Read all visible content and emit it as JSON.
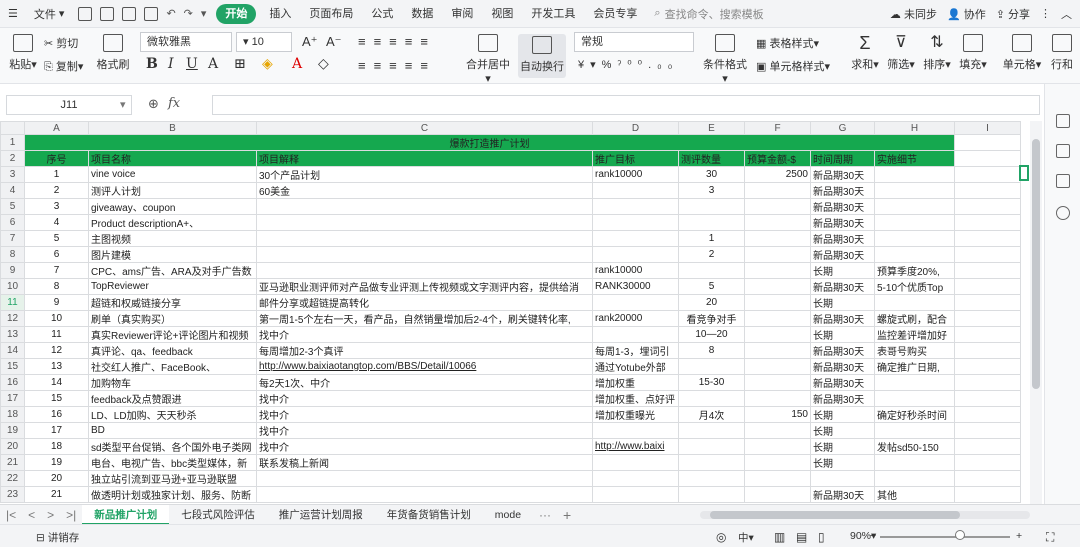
{
  "menubar": {
    "file": "文件",
    "tabs": [
      "开始",
      "插入",
      "页面布局",
      "公式",
      "数据",
      "审阅",
      "视图",
      "开发工具",
      "会员专享"
    ],
    "search_placeholder": "查找命令、搜索模板",
    "sync": "未同步",
    "collab": "协作",
    "share": "分享"
  },
  "ribbon": {
    "paste": "粘贴",
    "cut": "剪切",
    "copy": "复制",
    "format_painter": "格式刷",
    "font_name": "微软雅黑",
    "font_size": "10",
    "merge_center": "合并居中",
    "wrap_text": "自动换行",
    "number_format": "常规",
    "conditional": "条件格式",
    "table_style": "表格样式",
    "cell_style": "单元格样式",
    "sum": "求和",
    "filter": "筛选",
    "sort": "排序",
    "fill": "填充",
    "cell": "单元格",
    "rowcol": "行和"
  },
  "formula": {
    "cell_ref": "J11",
    "fx": "fx",
    "value": ""
  },
  "columns": [
    "A",
    "B",
    "C",
    "D",
    "E",
    "F",
    "G",
    "H",
    "I"
  ],
  "title": "爆款打造推广计划",
  "headers": [
    "序号",
    "项目名称",
    "项目解释",
    "推广目标",
    "测评数量",
    "预算金额-$",
    "时间周期",
    "实施细节"
  ],
  "rows": [
    {
      "r": "3",
      "a": "1",
      "b": "vine voice",
      "c": "30个产品计划",
      "d": "rank10000",
      "e": "30",
      "f": "2500",
      "g": "新品期30天",
      "h": ""
    },
    {
      "r": "4",
      "a": "2",
      "b": "测评人计划",
      "c": "60美金",
      "d": "",
      "e": "3",
      "f": "",
      "g": "新品期30天",
      "h": ""
    },
    {
      "r": "5",
      "a": "3",
      "b": "giveaway、coupon",
      "c": "",
      "d": "",
      "e": "",
      "f": "",
      "g": "新品期30天",
      "h": ""
    },
    {
      "r": "6",
      "a": "4",
      "b": "Product descriptionA+、",
      "c": "",
      "d": "",
      "e": "",
      "f": "",
      "g": "新品期30天",
      "h": ""
    },
    {
      "r": "7",
      "a": "5",
      "b": "主图视频",
      "c": "",
      "d": "",
      "e": "1",
      "f": "",
      "g": "新品期30天",
      "h": ""
    },
    {
      "r": "8",
      "a": "6",
      "b": "图片建模",
      "c": "",
      "d": "",
      "e": "2",
      "f": "",
      "g": "新品期30天",
      "h": ""
    },
    {
      "r": "9",
      "a": "7",
      "b": "CPC、ams广告、ARA及对手广告数",
      "c": "",
      "d": "rank10000",
      "e": "",
      "f": "",
      "g": "长期",
      "h": "预算季度20%,"
    },
    {
      "r": "10",
      "a": "8",
      "b": "TopReviewer",
      "c": "亚马逊职业测评师对产品做专业评测上传视频或文字测评内容，提供给消",
      "d": "RANK30000",
      "e": "5",
      "f": "",
      "g": "新品期30天",
      "h": "5-10个优质Top"
    },
    {
      "r": "11",
      "a": "9",
      "b": "超链和权威链接分享",
      "c": "邮件分享或超链提高转化",
      "d": "",
      "e": "20",
      "f": "",
      "g": "长期",
      "h": ""
    },
    {
      "r": "12",
      "a": "10",
      "b": "刷单（真实购买）",
      "c": "第一周1-5个左右一天，看产品，自然销量增加后2-4个，刷关键转化率,",
      "d": "rank20000",
      "e": "看竞争对手",
      "f": "",
      "g": "新品期30天",
      "h": "螺旋式刷，配合"
    },
    {
      "r": "13",
      "a": "11",
      "b": "真实Reviewer评论+评论图片和视频",
      "c": "找中介",
      "d": "",
      "e": "10—20",
      "f": "",
      "g": "长期",
      "h": "监控差评增加好"
    },
    {
      "r": "14",
      "a": "12",
      "b": "真评论、qa、feedback",
      "c": "每周增加2-3个真评",
      "d": "每周1-3，埋词引",
      "e": "8",
      "f": "",
      "g": "新品期30天",
      "h": "表哥号购买"
    },
    {
      "r": "15",
      "a": "13",
      "b": "社交红人推广、FaceBook、",
      "c": "http://www.baixiaotangtop.com/BBS/Detail/10066",
      "d": "通过Yotube外部",
      "e": "",
      "f": "",
      "g": "新品期30天",
      "h": "确定推广日期,"
    },
    {
      "r": "16",
      "a": "14",
      "b": "加购物车",
      "c": "每2天1次、中介",
      "d": "增加权重",
      "e": "15-30",
      "f": "",
      "g": "新品期30天",
      "h": ""
    },
    {
      "r": "17",
      "a": "15",
      "b": "feedback及点赞跟进",
      "c": "找中介",
      "d": "增加权重、点好评",
      "e": "",
      "f": "",
      "g": "新品期30天",
      "h": ""
    },
    {
      "r": "18",
      "a": "16",
      "b": "LD、LD加购、天天秒杀",
      "c": "找中介",
      "d": "增加权重曝光",
      "e": "月4次",
      "f": "150",
      "g": "长期",
      "h": "确定好秒杀时间"
    },
    {
      "r": "19",
      "a": "17",
      "b": "BD",
      "c": "找中介",
      "d": "",
      "e": "",
      "f": "",
      "g": "长期",
      "h": ""
    },
    {
      "r": "20",
      "a": "18",
      "b": "sd类型平台促销、各个国外电子类网",
      "c": "找中介",
      "d": "http://www.baixi",
      "e": "",
      "f": "",
      "g": "长期",
      "h": "发帖sd50-150"
    },
    {
      "r": "21",
      "a": "19",
      "b": "电台、电视广告、bbc类型媒体，新",
      "c": "联系发稿上新闻",
      "d": "",
      "e": "",
      "f": "",
      "g": "长期",
      "h": ""
    },
    {
      "r": "22",
      "a": "20",
      "b": "独立站引流到亚马逊+亚马逊联盟",
      "c": "",
      "d": "",
      "e": "",
      "f": "",
      "g": "",
      "h": ""
    },
    {
      "r": "23",
      "a": "21",
      "b": "做透明计划或独家计划、服务、防断",
      "c": "",
      "d": "",
      "e": "",
      "f": "",
      "g": "新品期30天",
      "h": "其他"
    }
  ],
  "sheet_tabs": [
    "新品推广计划",
    "七段式风险评估",
    "推广运营计划周报",
    "年货备货销售计划",
    "mode"
  ],
  "status": {
    "macro": "讲销存",
    "zoom": "90%"
  }
}
